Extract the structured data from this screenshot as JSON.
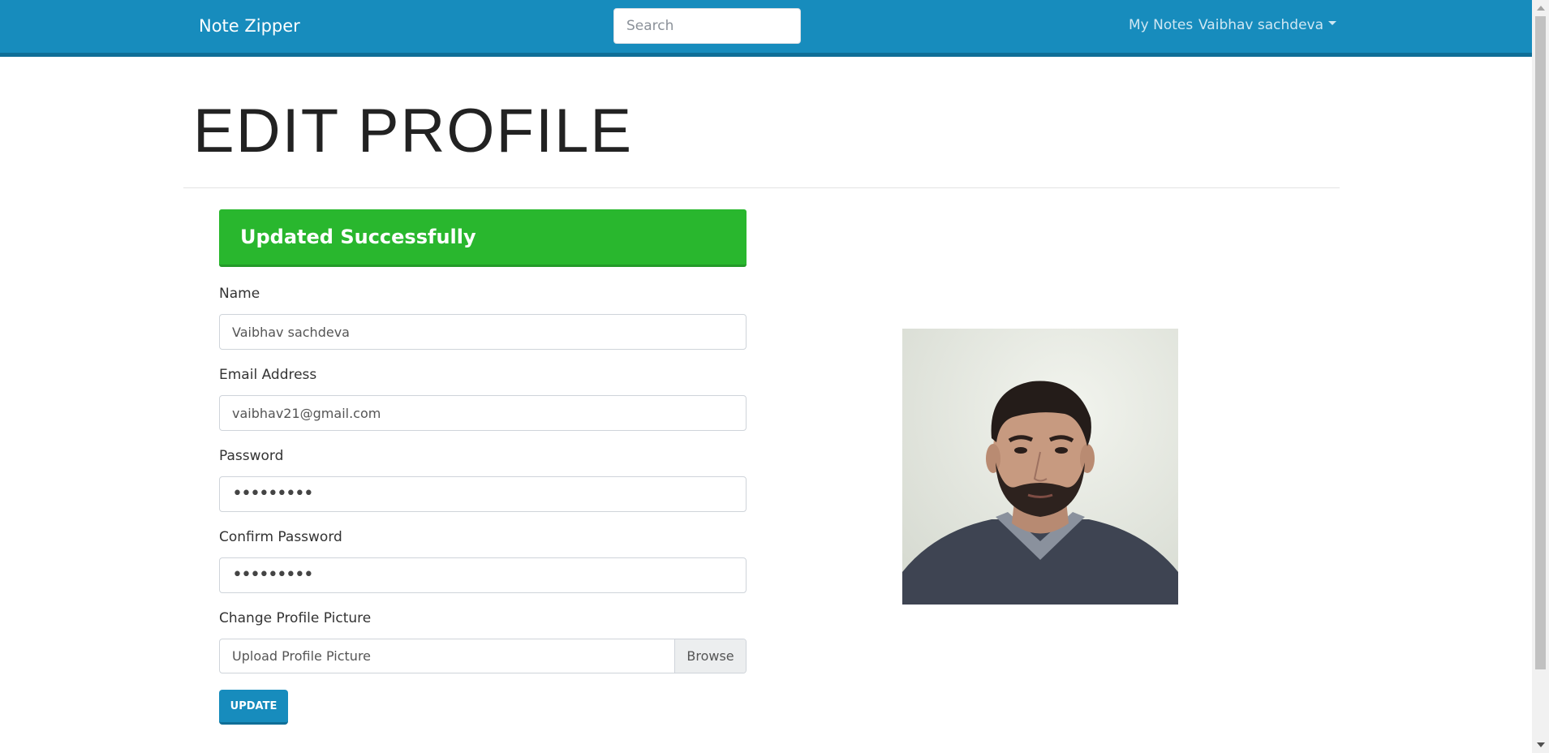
{
  "navbar": {
    "brand": "Note Zipper",
    "search_placeholder": "Search",
    "my_notes": "My Notes",
    "user_name": "Vaibhav sachdeva"
  },
  "page": {
    "title": "EDIT PROFILE"
  },
  "alert": {
    "message": "Updated Successfully",
    "color": "#29b72e"
  },
  "form": {
    "name_label": "Name",
    "name_value": "Vaibhav sachdeva",
    "email_label": "Email Address",
    "email_value": "vaibhav21@gmail.com",
    "password_label": "Password",
    "password_value": "•••••••••",
    "confirm_label": "Confirm Password",
    "confirm_value": "•••••••••",
    "picture_label": "Change Profile Picture",
    "picture_placeholder": "Upload Profile Picture",
    "browse_label": "Browse",
    "submit_label": "UPDATE"
  },
  "theme": {
    "primary": "#178cbd",
    "success": "#29b72e"
  }
}
